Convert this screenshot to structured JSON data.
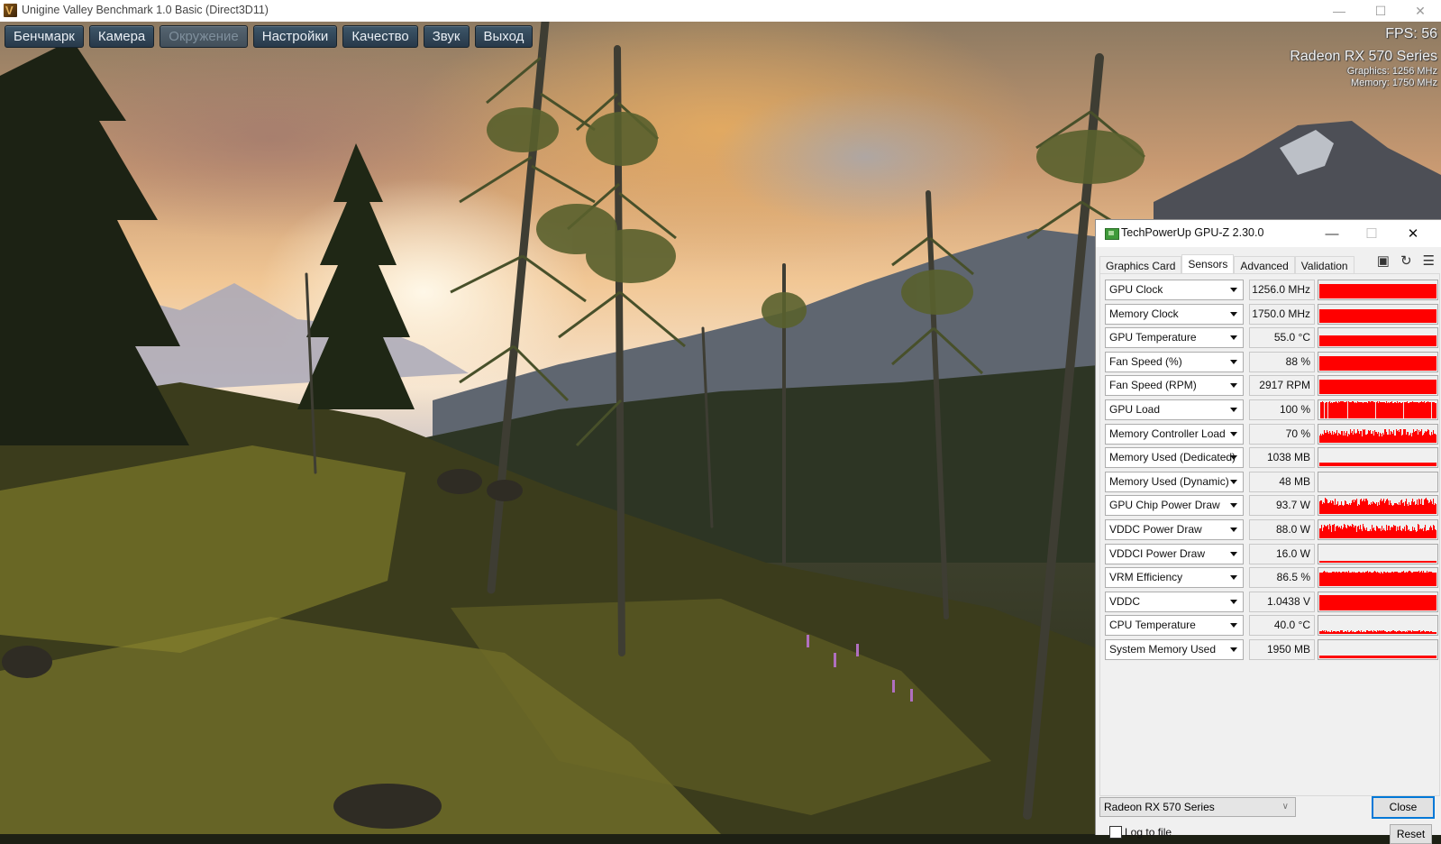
{
  "window": {
    "title": "Unigine Valley Benchmark 1.0 Basic (Direct3D11)",
    "controls": {
      "minimize": "—",
      "maximize": "☐",
      "close": "✕"
    }
  },
  "menu": [
    {
      "label": "Бенчмарк",
      "disabled": false
    },
    {
      "label": "Камера",
      "disabled": false
    },
    {
      "label": "Окружение",
      "disabled": true
    },
    {
      "label": "Настройки",
      "disabled": false
    },
    {
      "label": "Качество",
      "disabled": false
    },
    {
      "label": "Звук",
      "disabled": false
    },
    {
      "label": "Выход",
      "disabled": false
    }
  ],
  "overlay": {
    "fps": "FPS: 56",
    "gpu_name": "Radeon RX 570 Series",
    "graphics_clock": "Graphics: 1256 MHz",
    "memory_clock": "Memory: 1750 MHz"
  },
  "gpuz": {
    "title": "TechPowerUp GPU-Z 2.30.0",
    "controls": {
      "minimize": "—",
      "maximize": "☐",
      "close": "✕"
    },
    "tabs": [
      {
        "label": "Graphics Card",
        "active": false
      },
      {
        "label": "Sensors",
        "active": true
      },
      {
        "label": "Advanced",
        "active": false
      },
      {
        "label": "Validation",
        "active": false
      }
    ],
    "tool_icons": [
      "camera-icon",
      "refresh-icon",
      "menu-icon"
    ],
    "graph_color": "#ff0000",
    "sensors": [
      {
        "name": "GPU Clock",
        "value": "1256.0 MHz",
        "level": 0.82,
        "pattern": "flat"
      },
      {
        "name": "Memory Clock",
        "value": "1750.0 MHz",
        "level": 0.8,
        "pattern": "flat"
      },
      {
        "name": "GPU Temperature",
        "value": "55.0 °C",
        "level": 0.62,
        "pattern": "flat"
      },
      {
        "name": "Fan Speed (%)",
        "value": "88 %",
        "level": 0.85,
        "pattern": "flat"
      },
      {
        "name": "Fan Speed (RPM)",
        "value": "2917 RPM",
        "level": 0.82,
        "pattern": "flat"
      },
      {
        "name": "GPU Load",
        "value": "100 %",
        "level": 0.95,
        "pattern": "gaps"
      },
      {
        "name": "Memory Controller Load",
        "value": "70 %",
        "level": 0.6,
        "pattern": "noisy"
      },
      {
        "name": "Memory Used (Dedicated)",
        "value": "1038 MB",
        "level": 0.22,
        "pattern": "flat"
      },
      {
        "name": "Memory Used (Dynamic)",
        "value": "48 MB",
        "level": 0.0,
        "pattern": "flat"
      },
      {
        "name": "GPU Chip Power Draw",
        "value": "93.7 W",
        "level": 0.7,
        "pattern": "noisy"
      },
      {
        "name": "VDDC Power Draw",
        "value": "88.0 W",
        "level": 0.6,
        "pattern": "noisy"
      },
      {
        "name": "VDDCI Power Draw",
        "value": "16.0 W",
        "level": 0.08,
        "pattern": "flat"
      },
      {
        "name": "VRM Efficiency",
        "value": "86.5 %",
        "level": 0.82,
        "pattern": "noisy-small"
      },
      {
        "name": "VDDC",
        "value": "1.0438 V",
        "level": 0.9,
        "pattern": "flat"
      },
      {
        "name": "CPU Temperature",
        "value": "40.0 °C",
        "level": 0.15,
        "pattern": "noisy-small"
      },
      {
        "name": "System Memory Used",
        "value": "1950 MB",
        "level": 0.18,
        "pattern": "flat"
      }
    ],
    "log_to_file": {
      "label": "Log to file",
      "checked": false
    },
    "reset_label": "Reset",
    "gpu_select": "Radeon RX 570 Series",
    "close_label": "Close"
  }
}
